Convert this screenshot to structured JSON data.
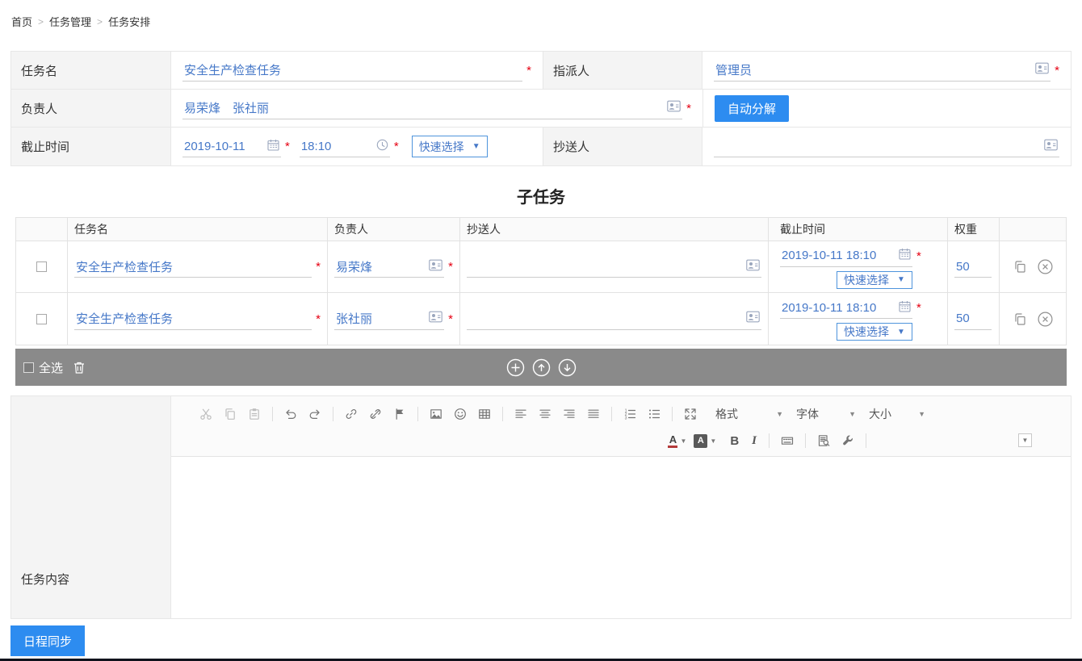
{
  "breadcrumb": {
    "separator": ">",
    "items": [
      {
        "label": "首页"
      },
      {
        "label": "任务管理"
      },
      {
        "label": "任务安排"
      }
    ]
  },
  "misc": {
    "required": "*",
    "caret_down": "▼",
    "caret_tiny": "▼"
  },
  "form": {
    "task_name": {
      "label": "任务名",
      "value": "安全生产检查任务"
    },
    "assigner": {
      "label": "指派人",
      "value": "管理员"
    },
    "responsible": {
      "label": "负责人",
      "value": "易荣烽　张社丽"
    },
    "auto_decompose_button": "自动分解",
    "deadline": {
      "label": "截止时间",
      "date": "2019-10-11",
      "time": "18:10"
    },
    "quick_select_label": "快速选择",
    "cc": {
      "label": "抄送人",
      "value": ""
    }
  },
  "subtasks": {
    "title": "子任务",
    "headers": {
      "task_name": "任务名",
      "responsible": "负责人",
      "cc": "抄送人",
      "deadline": "截止时间",
      "weight": "权重"
    },
    "rows": [
      {
        "task_name": "安全生产检查任务",
        "responsible": "易荣烽",
        "cc": "",
        "deadline": "2019-10-11 18:10",
        "quick_select": "快速选择",
        "weight": "50"
      },
      {
        "task_name": "安全生产检查任务",
        "responsible": "张社丽",
        "cc": "",
        "deadline": "2019-10-11 18:10",
        "quick_select": "快速选择",
        "weight": "50"
      }
    ],
    "select_all_label": "全选"
  },
  "content": {
    "label": "任务内容",
    "editor": {
      "format_combo": "格式",
      "font_combo": "字体",
      "size_combo": "大小"
    }
  },
  "actions": {
    "schedule_sync_button": "日程同步"
  },
  "colors": {
    "link_blue": "#4678c8",
    "primary_blue": "#2d8cf0",
    "required_red": "#e60012",
    "label_bg": "#f4f4f4",
    "selection_bar_gray": "#8a8a8a"
  }
}
